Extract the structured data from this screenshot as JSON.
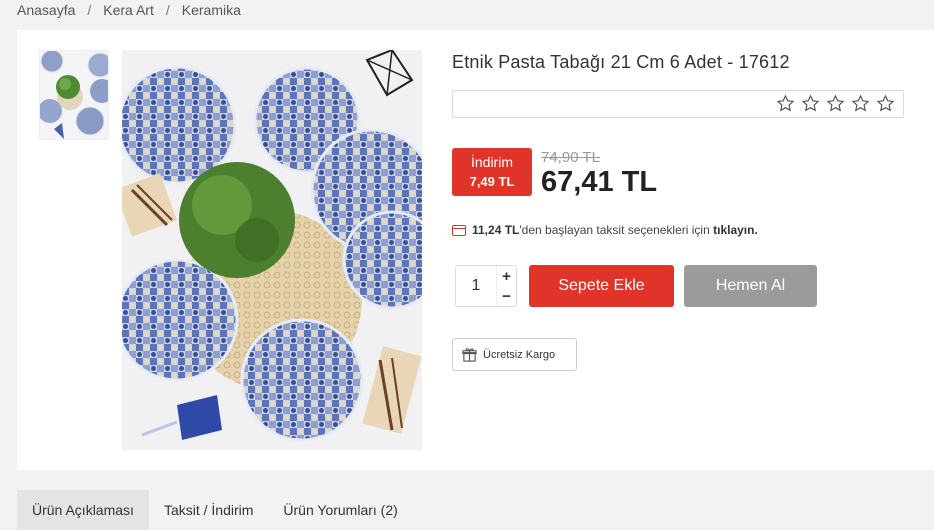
{
  "breadcrumb": {
    "items": [
      "Anasayfa",
      "Kera Art",
      "Keramika"
    ],
    "separator": "/"
  },
  "product": {
    "title": "Etnik Pasta Tabağı 21 Cm 6 Adet - 17612",
    "rating": {
      "stars": 0,
      "max": 5
    },
    "discount_label": "İndirim",
    "discount_amount": "7,49 TL",
    "old_price": "74,90 TL",
    "price": "67,41 TL",
    "installment": {
      "amount": "11,24 TL",
      "text": "'den başlayan taksit seçenekleri için ",
      "link": "tıklayın."
    },
    "quantity": "1",
    "qty_plus": "+",
    "qty_minus": "−",
    "add_to_cart": "Sepete Ekle",
    "buy_now": "Hemen Al",
    "shipping": "Ücretsiz Kargo"
  },
  "tabs": [
    {
      "label": "Ürün Açıklaması",
      "active": true
    },
    {
      "label": "Taksit / İndirim",
      "active": false
    },
    {
      "label": "Ürün Yorumları (2)",
      "active": false
    }
  ],
  "colors": {
    "accent": "#e0342a",
    "secondary_button": "#9b9b9b",
    "background": "#f2f2f2"
  }
}
